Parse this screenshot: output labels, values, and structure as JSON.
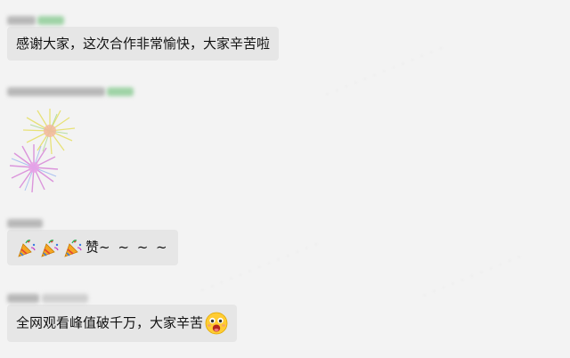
{
  "messages": [
    {
      "text": "感谢大家，这次合作非常愉快，大家辛苦啦"
    },
    {
      "sticker": "fireworks-sticker"
    },
    {
      "text": "赞",
      "suffix": "~ ~ ~ ~",
      "icons": [
        "party-popper-icon",
        "party-popper-icon",
        "party-popper-icon"
      ]
    },
    {
      "text": "全网观看峰值破千万，大家辛苦",
      "icons": [
        "laughing-face-icon"
      ]
    }
  ],
  "colors": {
    "background": "#f3f3f3",
    "bubble": "#e6e6e6",
    "text": "#111111",
    "name_blur_green": "#9fd3a6"
  }
}
